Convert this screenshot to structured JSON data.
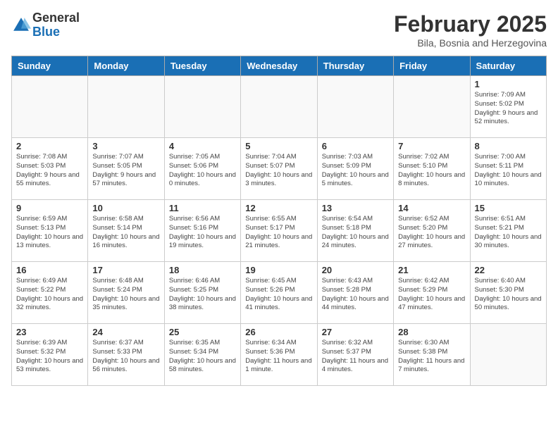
{
  "header": {
    "logo_general": "General",
    "logo_blue": "Blue",
    "month_title": "February 2025",
    "location": "Bila, Bosnia and Herzegovina"
  },
  "days_of_week": [
    "Sunday",
    "Monday",
    "Tuesday",
    "Wednesday",
    "Thursday",
    "Friday",
    "Saturday"
  ],
  "weeks": [
    [
      {
        "day": "",
        "info": ""
      },
      {
        "day": "",
        "info": ""
      },
      {
        "day": "",
        "info": ""
      },
      {
        "day": "",
        "info": ""
      },
      {
        "day": "",
        "info": ""
      },
      {
        "day": "",
        "info": ""
      },
      {
        "day": "1",
        "info": "Sunrise: 7:09 AM\nSunset: 5:02 PM\nDaylight: 9 hours and 52 minutes."
      }
    ],
    [
      {
        "day": "2",
        "info": "Sunrise: 7:08 AM\nSunset: 5:03 PM\nDaylight: 9 hours and 55 minutes."
      },
      {
        "day": "3",
        "info": "Sunrise: 7:07 AM\nSunset: 5:05 PM\nDaylight: 9 hours and 57 minutes."
      },
      {
        "day": "4",
        "info": "Sunrise: 7:05 AM\nSunset: 5:06 PM\nDaylight: 10 hours and 0 minutes."
      },
      {
        "day": "5",
        "info": "Sunrise: 7:04 AM\nSunset: 5:07 PM\nDaylight: 10 hours and 3 minutes."
      },
      {
        "day": "6",
        "info": "Sunrise: 7:03 AM\nSunset: 5:09 PM\nDaylight: 10 hours and 5 minutes."
      },
      {
        "day": "7",
        "info": "Sunrise: 7:02 AM\nSunset: 5:10 PM\nDaylight: 10 hours and 8 minutes."
      },
      {
        "day": "8",
        "info": "Sunrise: 7:00 AM\nSunset: 5:11 PM\nDaylight: 10 hours and 10 minutes."
      }
    ],
    [
      {
        "day": "9",
        "info": "Sunrise: 6:59 AM\nSunset: 5:13 PM\nDaylight: 10 hours and 13 minutes."
      },
      {
        "day": "10",
        "info": "Sunrise: 6:58 AM\nSunset: 5:14 PM\nDaylight: 10 hours and 16 minutes."
      },
      {
        "day": "11",
        "info": "Sunrise: 6:56 AM\nSunset: 5:16 PM\nDaylight: 10 hours and 19 minutes."
      },
      {
        "day": "12",
        "info": "Sunrise: 6:55 AM\nSunset: 5:17 PM\nDaylight: 10 hours and 21 minutes."
      },
      {
        "day": "13",
        "info": "Sunrise: 6:54 AM\nSunset: 5:18 PM\nDaylight: 10 hours and 24 minutes."
      },
      {
        "day": "14",
        "info": "Sunrise: 6:52 AM\nSunset: 5:20 PM\nDaylight: 10 hours and 27 minutes."
      },
      {
        "day": "15",
        "info": "Sunrise: 6:51 AM\nSunset: 5:21 PM\nDaylight: 10 hours and 30 minutes."
      }
    ],
    [
      {
        "day": "16",
        "info": "Sunrise: 6:49 AM\nSunset: 5:22 PM\nDaylight: 10 hours and 32 minutes."
      },
      {
        "day": "17",
        "info": "Sunrise: 6:48 AM\nSunset: 5:24 PM\nDaylight: 10 hours and 35 minutes."
      },
      {
        "day": "18",
        "info": "Sunrise: 6:46 AM\nSunset: 5:25 PM\nDaylight: 10 hours and 38 minutes."
      },
      {
        "day": "19",
        "info": "Sunrise: 6:45 AM\nSunset: 5:26 PM\nDaylight: 10 hours and 41 minutes."
      },
      {
        "day": "20",
        "info": "Sunrise: 6:43 AM\nSunset: 5:28 PM\nDaylight: 10 hours and 44 minutes."
      },
      {
        "day": "21",
        "info": "Sunrise: 6:42 AM\nSunset: 5:29 PM\nDaylight: 10 hours and 47 minutes."
      },
      {
        "day": "22",
        "info": "Sunrise: 6:40 AM\nSunset: 5:30 PM\nDaylight: 10 hours and 50 minutes."
      }
    ],
    [
      {
        "day": "23",
        "info": "Sunrise: 6:39 AM\nSunset: 5:32 PM\nDaylight: 10 hours and 53 minutes."
      },
      {
        "day": "24",
        "info": "Sunrise: 6:37 AM\nSunset: 5:33 PM\nDaylight: 10 hours and 56 minutes."
      },
      {
        "day": "25",
        "info": "Sunrise: 6:35 AM\nSunset: 5:34 PM\nDaylight: 10 hours and 58 minutes."
      },
      {
        "day": "26",
        "info": "Sunrise: 6:34 AM\nSunset: 5:36 PM\nDaylight: 11 hours and 1 minute."
      },
      {
        "day": "27",
        "info": "Sunrise: 6:32 AM\nSunset: 5:37 PM\nDaylight: 11 hours and 4 minutes."
      },
      {
        "day": "28",
        "info": "Sunrise: 6:30 AM\nSunset: 5:38 PM\nDaylight: 11 hours and 7 minutes."
      },
      {
        "day": "",
        "info": ""
      }
    ]
  ]
}
